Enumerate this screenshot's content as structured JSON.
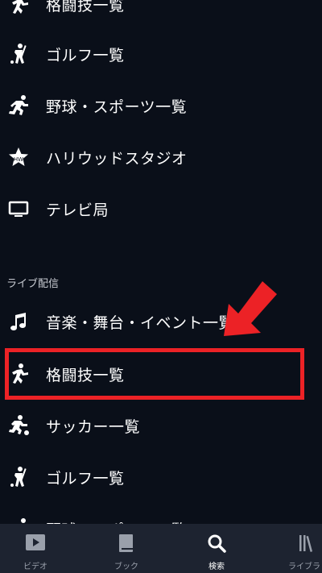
{
  "menu_top": {
    "items": [
      {
        "label": "格闘技一覧",
        "icon": "fighting-icon"
      },
      {
        "label": "ゴルフ一覧",
        "icon": "golf-icon"
      },
      {
        "label": "野球・スポーツ一覧",
        "icon": "running-icon"
      },
      {
        "label": "ハリウッドスタジオ",
        "icon": "star-icon"
      },
      {
        "label": "テレビ局",
        "icon": "tv-icon"
      }
    ]
  },
  "live": {
    "header": "ライブ配信",
    "items": [
      {
        "label": "音楽・舞台・イベント一覧",
        "icon": "music-note-icon"
      },
      {
        "label": "格闘技一覧",
        "icon": "fighting-icon"
      },
      {
        "label": "サッカー一覧",
        "icon": "soccer-icon"
      },
      {
        "label": "ゴルフ一覧",
        "icon": "golf-icon"
      },
      {
        "label": "野球・スポーツ一覧",
        "icon": "running-icon"
      }
    ]
  },
  "tabbar": {
    "tabs": [
      {
        "label": "ビデオ",
        "icon": "video-icon"
      },
      {
        "label": "ブック",
        "icon": "book-icon"
      },
      {
        "label": "検索",
        "icon": "search-icon",
        "active": true
      },
      {
        "label": "ライブラリ",
        "icon": "library-icon"
      }
    ]
  },
  "colors": {
    "background": "#0a0f19",
    "tabbar": "#1d2330",
    "annotation_red": "#ec2226"
  }
}
